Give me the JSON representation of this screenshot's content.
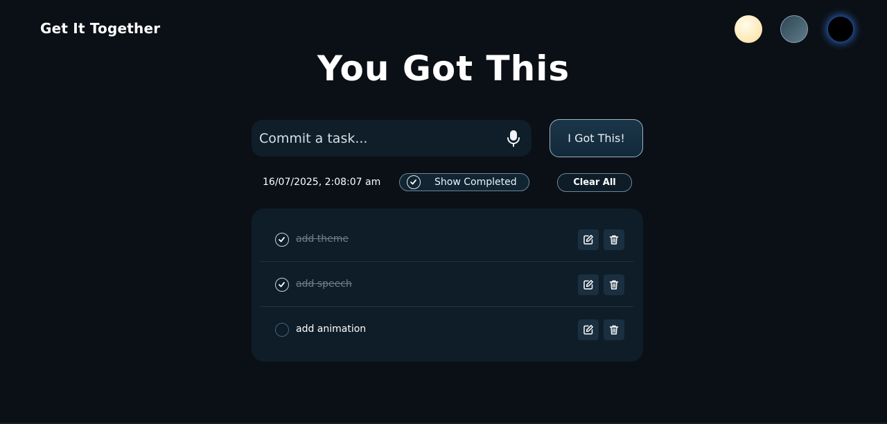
{
  "header": {
    "brand": "Get It Together",
    "themes": [
      {
        "name": "light",
        "color": "#fde7b3"
      },
      {
        "name": "mid",
        "color": "#3d5a6b"
      },
      {
        "name": "dark",
        "color": "#000000"
      }
    ]
  },
  "main": {
    "headline": "You Got This",
    "input": {
      "placeholder": "Commit a task...",
      "value": ""
    },
    "add_button": "I Got This!",
    "datetime": "16/07/2025, 2:08:07 am",
    "show_completed": {
      "label": "Show Completed",
      "checked": true
    },
    "clear_all": "Clear All"
  },
  "tasks": [
    {
      "text": "add theme",
      "completed": true
    },
    {
      "text": "add speech",
      "completed": true
    },
    {
      "text": "add animation",
      "completed": false
    }
  ],
  "colors": {
    "background": "#0b1016",
    "card": "#0f1d28",
    "accent_glow": "#3b82f6"
  }
}
